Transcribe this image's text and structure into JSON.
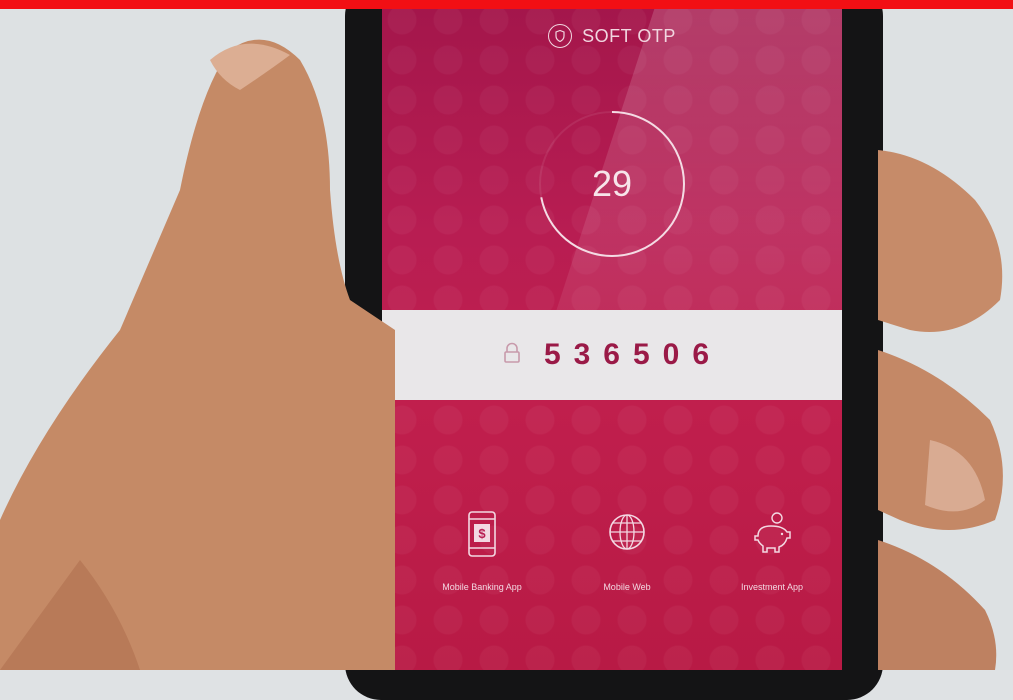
{
  "app": {
    "title": "SOFT OTP",
    "brand_color": "#b81d52",
    "header_icon": "shield-icon"
  },
  "timer": {
    "seconds_remaining": "29",
    "ring_fraction": 0.72
  },
  "otp": {
    "icon": "lock-icon",
    "code": "536506",
    "code_color": "#9a1a47"
  },
  "shortcuts": [
    {
      "icon": "mobile-dollar-icon",
      "label": "Mobile Banking App"
    },
    {
      "icon": "globe-icon",
      "label": "Mobile Web"
    },
    {
      "icon": "piggy-bank-icon",
      "label": "Investment App"
    }
  ]
}
